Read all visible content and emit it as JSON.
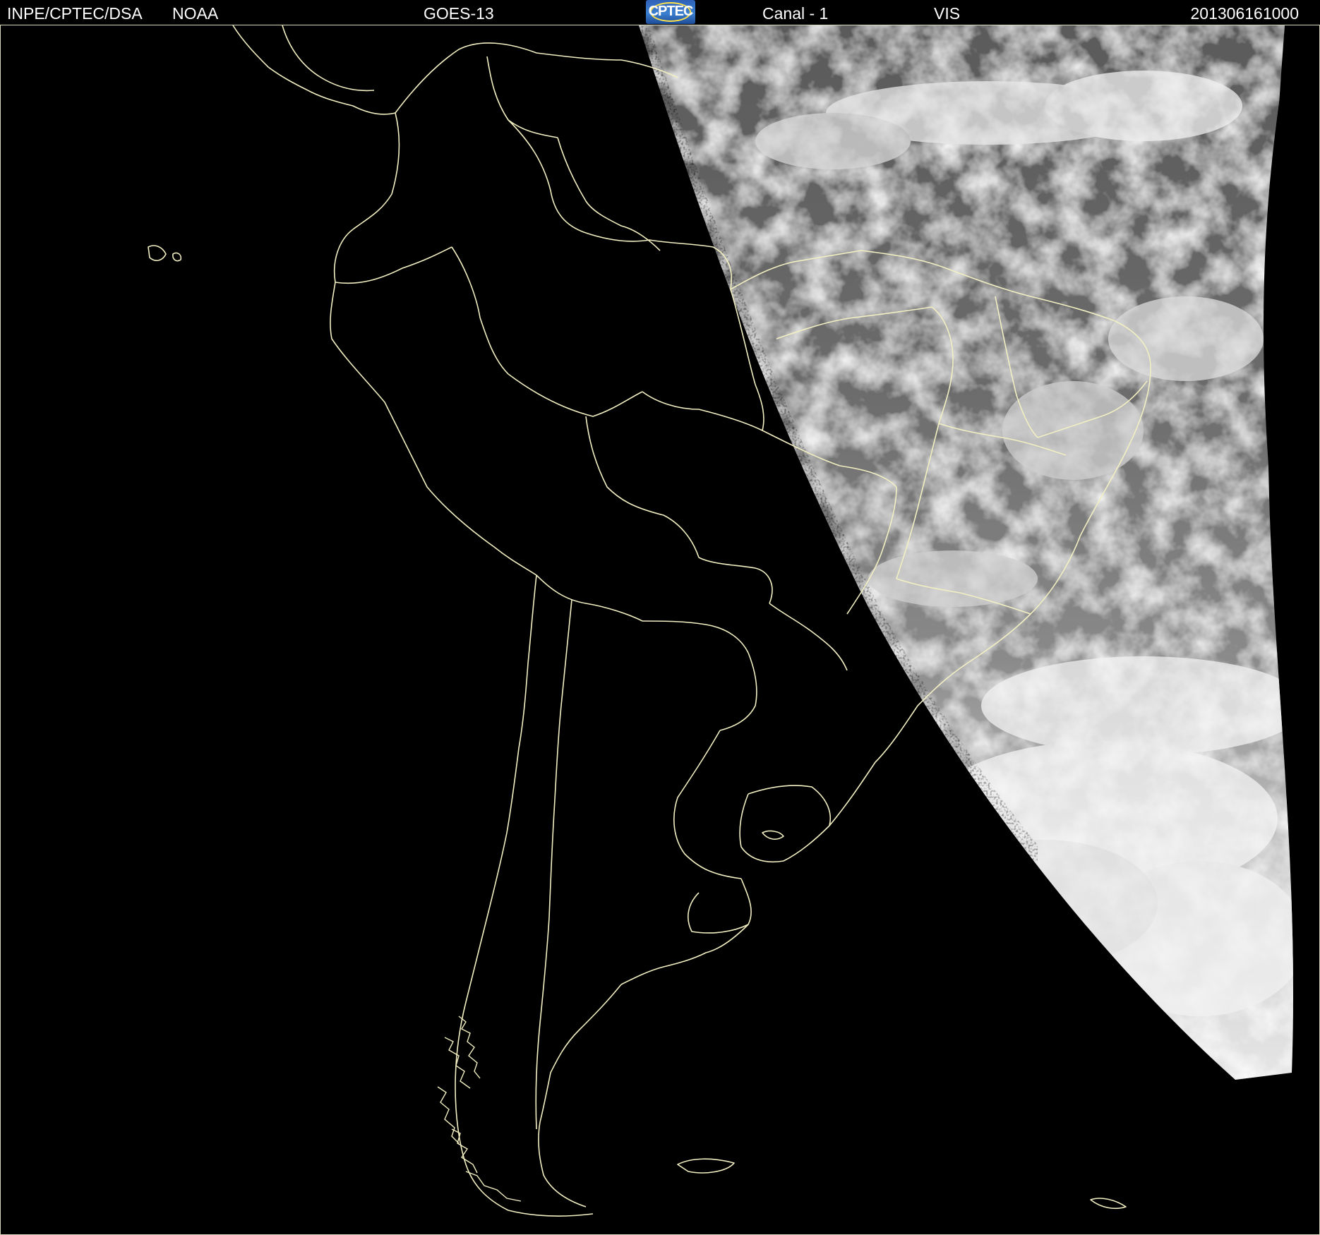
{
  "header": {
    "organization": "INPE/CPTEC/DSA",
    "agency": "NOAA",
    "satellite": "GOES-13",
    "logo_text": "CPTEC",
    "channel": "Canal - 1",
    "band": "VIS",
    "timestamp": "201306161000"
  },
  "colors": {
    "background": "#000000",
    "border_lines": "#f2efc2",
    "header_text": "#ffffff",
    "logo_blue": "#3b7fd0",
    "logo_ring": "#ffe14a"
  },
  "map": {
    "projection": "satellite visible-channel image",
    "overlay": "political boundaries",
    "illumination": "terminator dividing night (left) and daylight (right)"
  }
}
